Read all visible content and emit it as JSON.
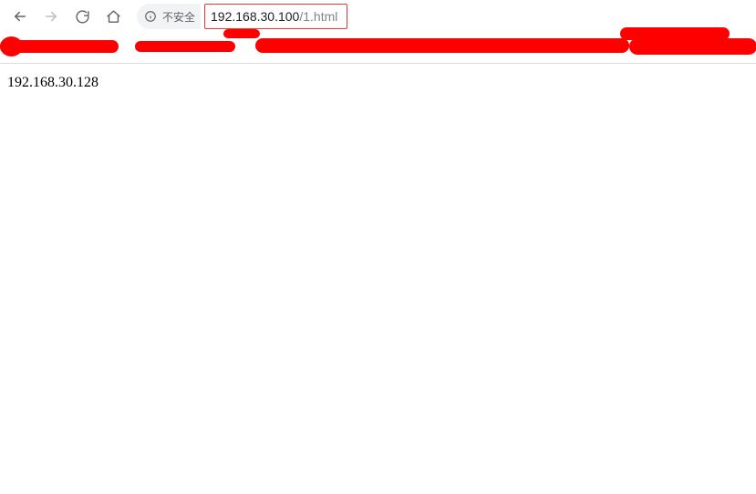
{
  "toolbar": {
    "site_security_label": "不安全",
    "url_host": "192.168.30.100",
    "url_path": "/1.html"
  },
  "page": {
    "body_text": "192.168.30.128"
  }
}
